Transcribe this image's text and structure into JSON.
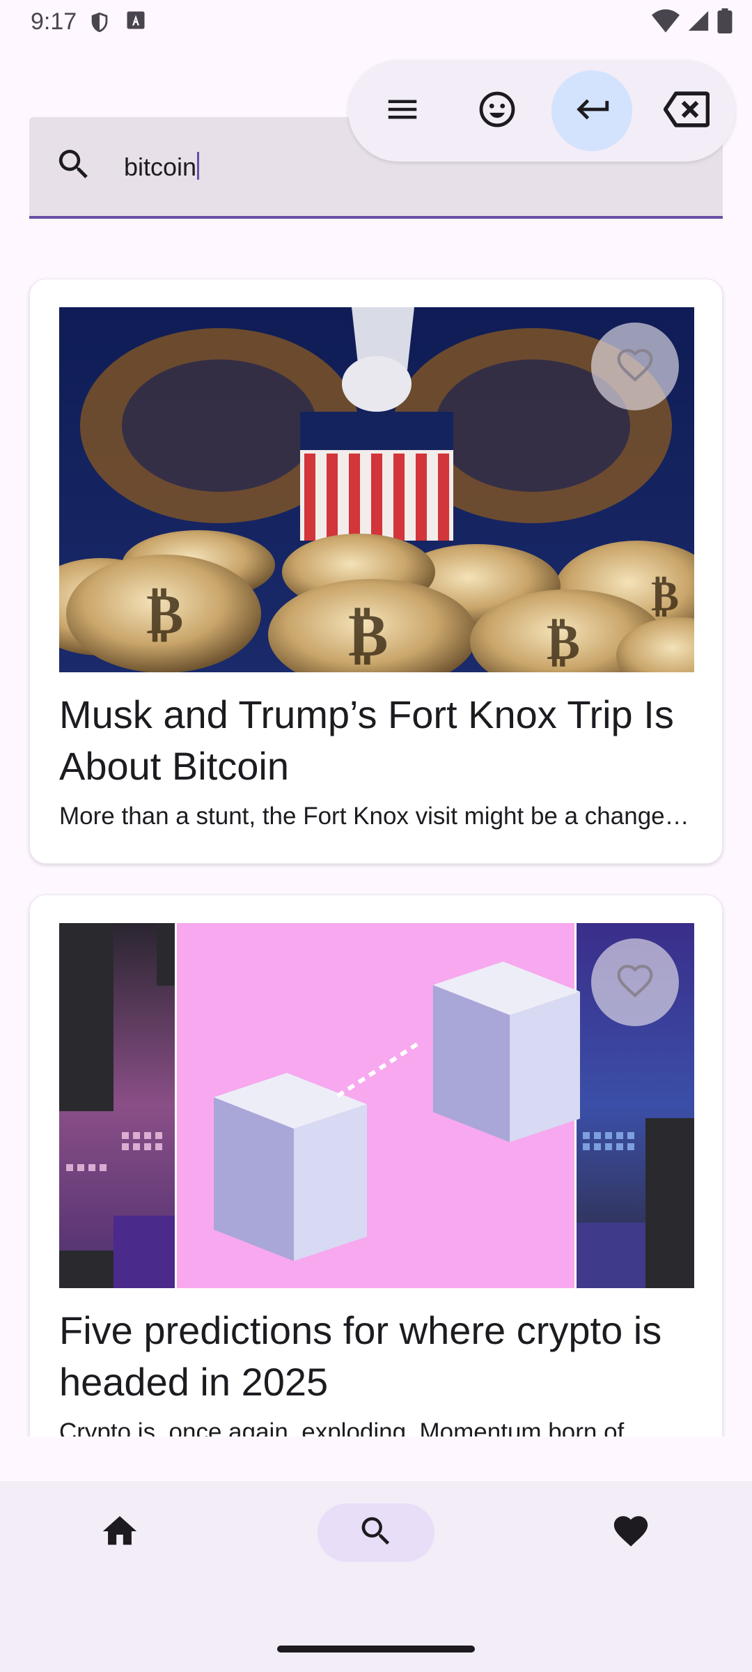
{
  "status_bar": {
    "time": "9:17",
    "icons": [
      "shield-icon",
      "keyboard-a-icon",
      "wifi-icon",
      "signal-icon",
      "battery-icon"
    ]
  },
  "search": {
    "query": "bitcoin",
    "icon": "search-icon"
  },
  "keyboard_toolbar": {
    "buttons": [
      "menu-icon",
      "emoji-icon",
      "enter-icon",
      "backspace-icon"
    ]
  },
  "articles": [
    {
      "title": "Musk and Trump’s Fort Knox Trip Is About Bitcoin",
      "description": "More than a stunt, the Fort Knox visit might be a change in how the government treats bitcoin.",
      "favorite_icon": "heart-outline-icon"
    },
    {
      "title": "Five predictions for where crypto is headed in 2025",
      "description": "Crypto is, once again, exploding. Momentum born of",
      "favorite_icon": "heart-outline-icon"
    }
  ],
  "bottom_nav": {
    "items": [
      "home-icon",
      "search-icon",
      "heart-icon"
    ],
    "active": "search"
  },
  "colors": {
    "accent": "#6750A4",
    "background": "#FEF7FF",
    "nav_background": "#F3EDF7",
    "nav_active": "#E8DEF8"
  }
}
